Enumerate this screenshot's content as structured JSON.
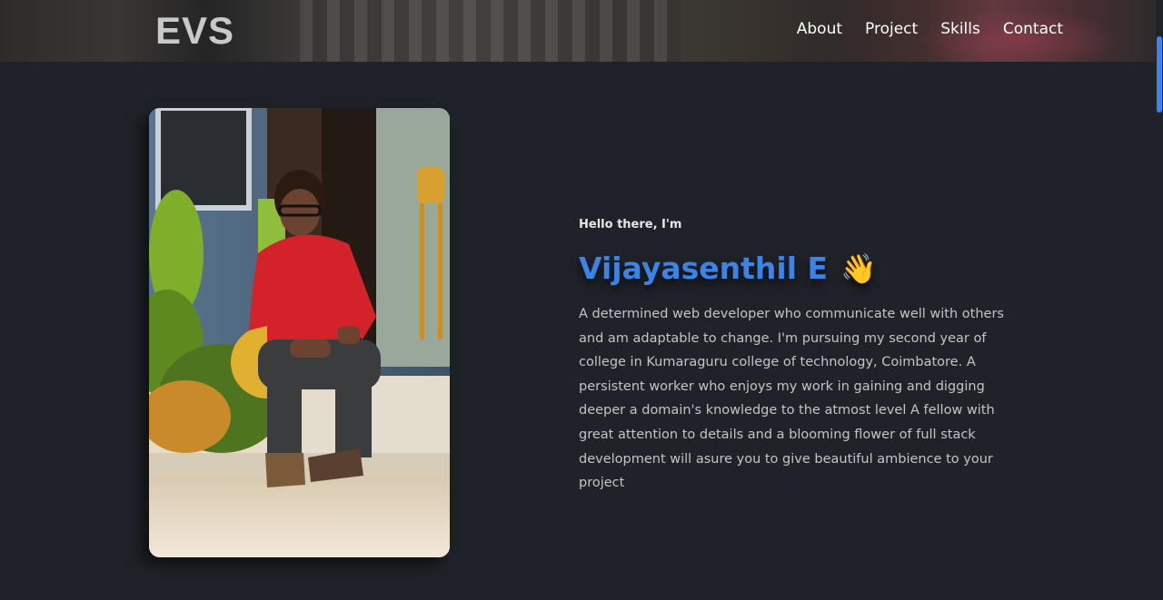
{
  "header": {
    "logo": "EVS",
    "nav": [
      {
        "label": "About"
      },
      {
        "label": "Project"
      },
      {
        "label": "Skills"
      },
      {
        "label": "Contact"
      }
    ]
  },
  "hero": {
    "greeting": "Hello there, I'm",
    "name": "Vijayasenthil E",
    "emoji": "👋",
    "bio": "A determined web developer who communicate well with others and am adaptable to change. I'm pursuing my second year of college in Kumaraguru college of technology, Coimbatore. A persistent worker who enjoys my work in gaining and digging deeper a domain's knowledge to the atmost level A fellow with great attention to details and a blooming flower of full stack development will asure you to give beautiful ambience to your project"
  },
  "colors": {
    "background": "#1f2228",
    "accent": "#3c83e8",
    "text": "#c4c4c4"
  }
}
